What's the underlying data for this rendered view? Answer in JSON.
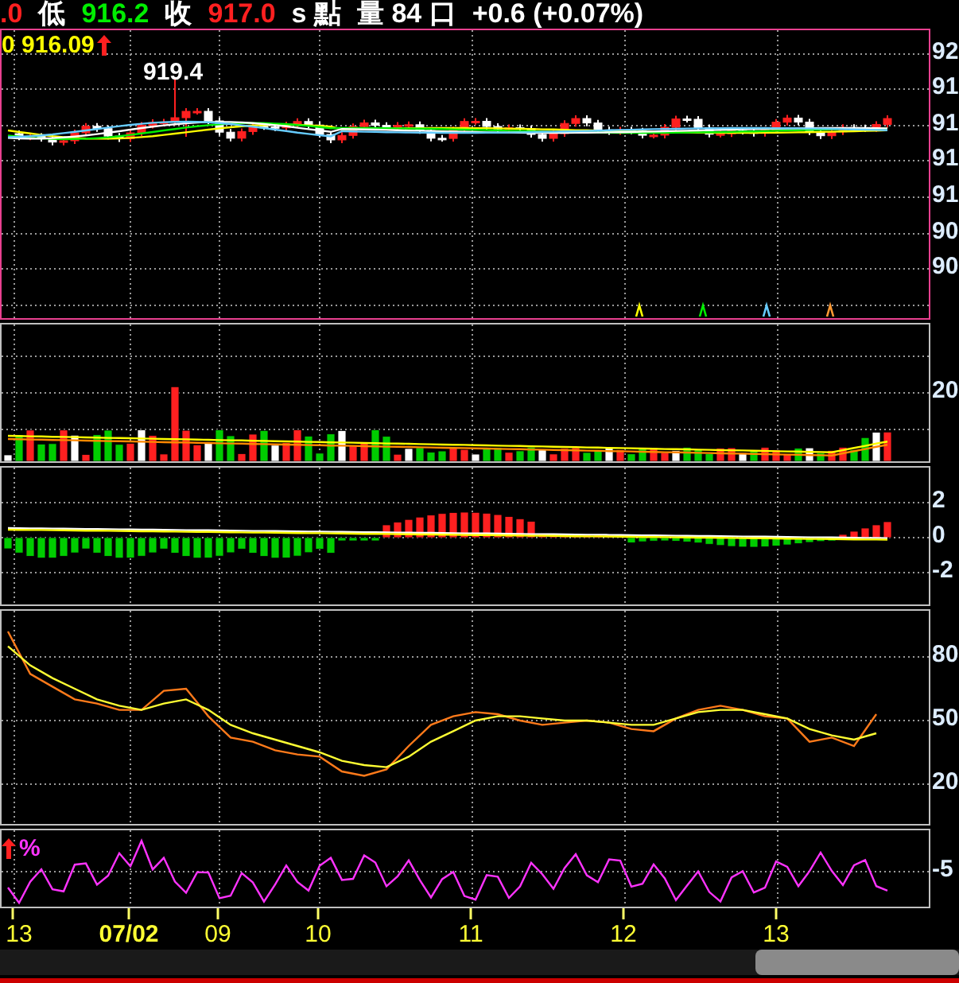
{
  "quote_bar": [
    {
      "text": ".0",
      "color": "#ff2020"
    },
    {
      "text": "低",
      "color": "#ffffff"
    },
    {
      "text": "916.2",
      "color": "#00ee00"
    },
    {
      "text": "收",
      "color": "#ffffff"
    },
    {
      "text": "917.0",
      "color": "#ff2020"
    },
    {
      "text": "s 點",
      "color": "#ffffff"
    },
    {
      "text": "量 84 口",
      "color": "#ffffff"
    },
    {
      "text": "+0.6 (+0.07%)",
      "color": "#ffffff"
    }
  ],
  "price_panel": {
    "readout": "0 916.09",
    "high_label": "919.4",
    "axis_labels": [
      "92",
      "91",
      "91",
      "91",
      "91",
      "90",
      "90"
    ],
    "signal_markers": [
      {
        "color": "#ffff00"
      },
      {
        "color": "#00ee00"
      },
      {
        "color": "#66ccff"
      },
      {
        "color": "#ff9933"
      }
    ]
  },
  "volume_panel": {
    "axis_labels": [
      "20"
    ]
  },
  "macd_panel": {
    "axis_labels": [
      "2",
      "0",
      "-2"
    ]
  },
  "kd_panel": {
    "chart_data": {
      "type": "line",
      "grid": true,
      "ylim": [
        1.25,
        101.75
      ],
      "yticks": [
        20,
        50,
        80
      ],
      "series": [
        {
          "color": "#ff7a1a",
          "values": [
            92,
            72,
            66,
            60,
            58,
            55,
            55,
            64,
            65,
            52,
            42,
            40,
            36,
            34,
            33,
            26,
            24,
            27,
            38,
            48,
            52,
            54,
            53,
            50,
            48,
            49,
            50,
            49,
            46,
            45,
            51,
            55,
            57,
            55,
            52,
            51,
            40,
            42,
            38,
            53
          ]
        },
        {
          "color": "#ffff33",
          "values": [
            85,
            76,
            70,
            65,
            60,
            57,
            55,
            58,
            60,
            55,
            48,
            44,
            41,
            38,
            35,
            31,
            29,
            28,
            33,
            40,
            45,
            50,
            52,
            52,
            51,
            50,
            50,
            49,
            48,
            48,
            51,
            54,
            55,
            55,
            53,
            51,
            46,
            43,
            41,
            44
          ]
        }
      ]
    }
  },
  "percent_panel": {
    "label": "%",
    "axis_labels": [
      "-5"
    ]
  },
  "date_axis": [
    {
      "text": "13",
      "highlight": false
    },
    {
      "text": "07/02",
      "highlight": true
    },
    {
      "text": "09",
      "highlight": false
    },
    {
      "text": "10",
      "highlight": false
    },
    {
      "text": "11",
      "highlight": false
    },
    {
      "text": "12",
      "highlight": false
    },
    {
      "text": "13",
      "highlight": false
    }
  ]
}
